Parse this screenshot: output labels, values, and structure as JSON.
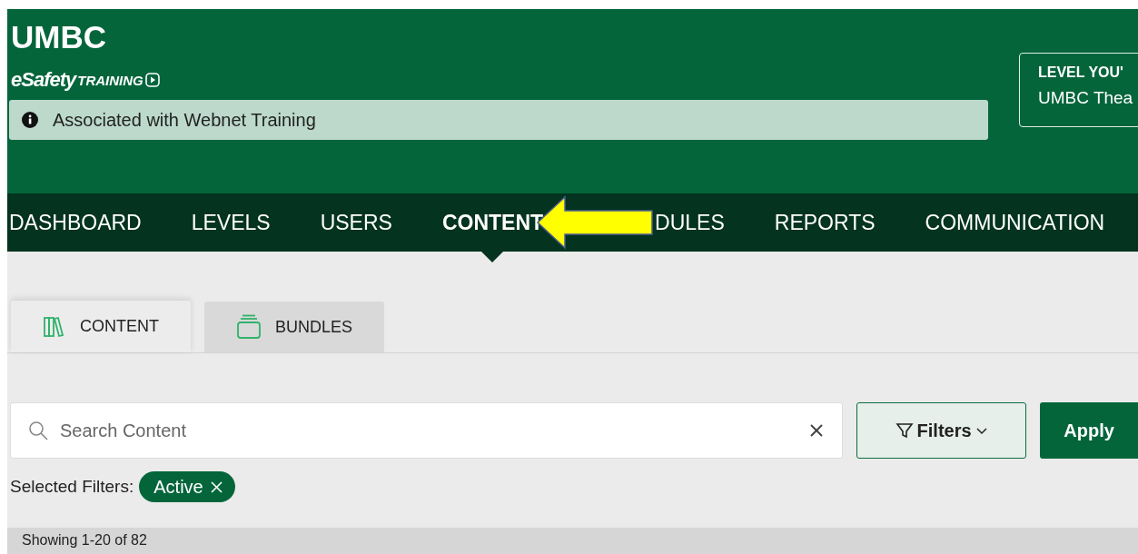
{
  "header": {
    "title": "UMBC",
    "logo": {
      "brand": "eSafety",
      "product": "TRAINING"
    },
    "notice": "Associated with Webnet Training",
    "level_box": {
      "heading": "LEVEL YOU'",
      "value": "UMBC Thea"
    }
  },
  "nav": {
    "items": [
      {
        "kind": "link",
        "label": "DASHBOARD",
        "selected": false
      },
      {
        "kind": "link",
        "label": "LEVELS",
        "selected": false
      },
      {
        "kind": "link",
        "label": "USERS",
        "selected": false
      },
      {
        "kind": "link",
        "label": "CONTENT",
        "selected": true
      },
      {
        "kind": "arrow"
      },
      {
        "kind": "link",
        "label": "DULES",
        "selected": false
      },
      {
        "kind": "link",
        "label": "REPORTS",
        "selected": false
      },
      {
        "kind": "link",
        "label": "COMMUNICATION",
        "selected": false
      }
    ]
  },
  "tabs": [
    {
      "label": "CONTENT",
      "selected": true
    },
    {
      "label": "BUNDLES",
      "selected": false
    }
  ],
  "search": {
    "placeholder": "Search Content",
    "filters_button": "Filters",
    "apply_button": "Apply"
  },
  "selected_filters": {
    "label": "Selected Filters:",
    "chips": [
      "Active"
    ]
  },
  "results": {
    "summary": "Showing 1-20 of 82"
  }
}
